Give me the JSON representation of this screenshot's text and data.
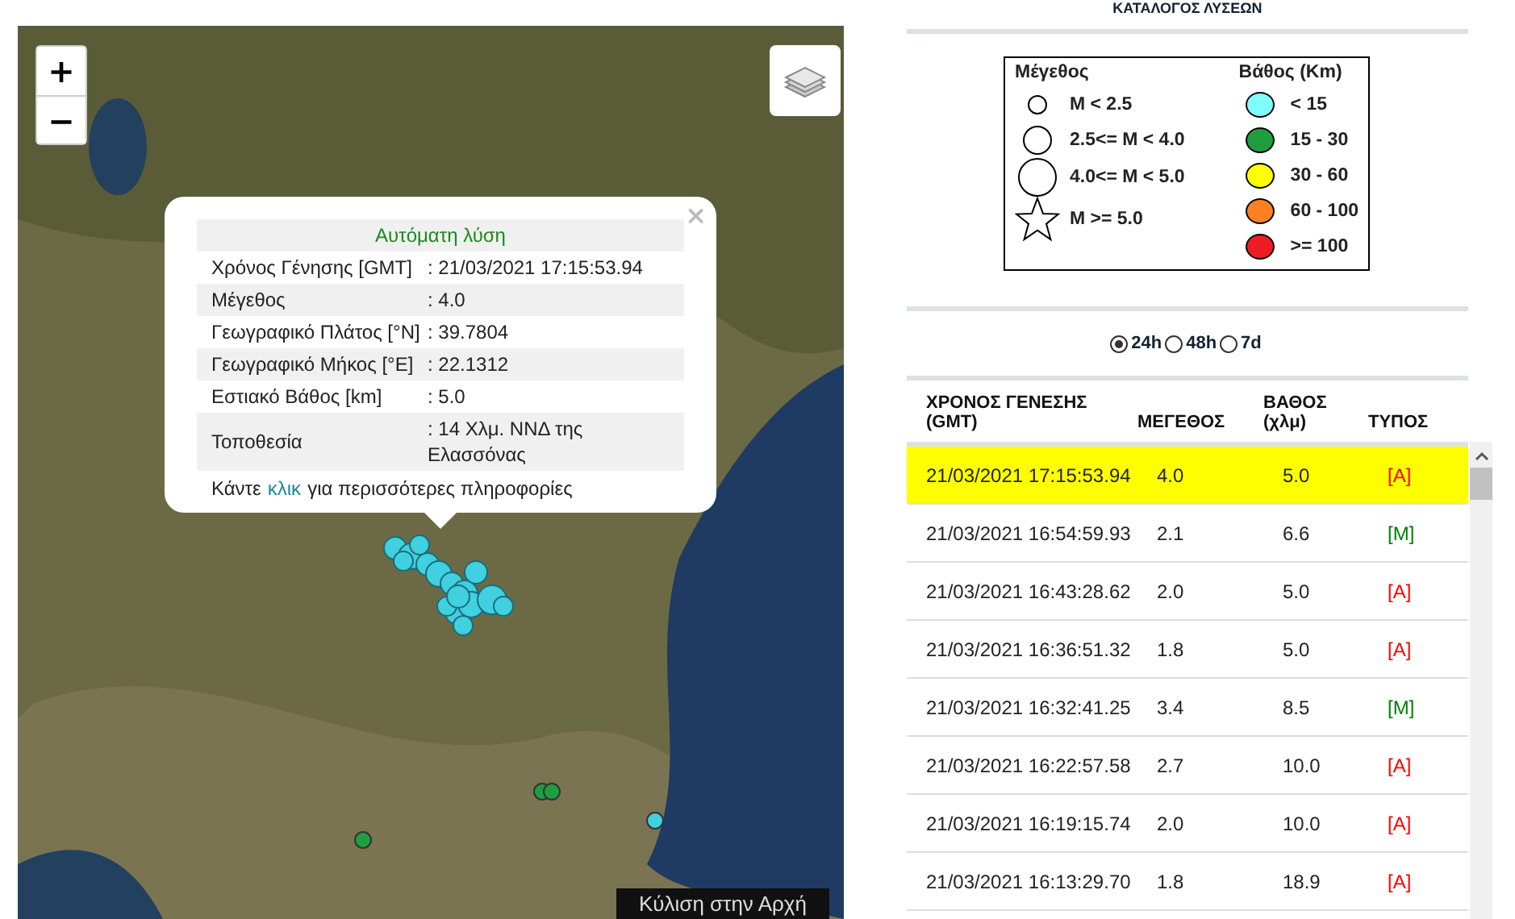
{
  "map": {
    "zoom_in": "+",
    "zoom_out": "−",
    "scroll_top": "Κύλιση στην Αρχή",
    "popup": {
      "close": "×",
      "title": "Αυτόματη λύση",
      "rows": [
        {
          "label": "Χρόνος Γένησης [GMT]",
          "value": ": 21/03/2021 17:15:53.94"
        },
        {
          "label": "Μέγεθος",
          "value": ": 4.0"
        },
        {
          "label": "Γεωγραφικό Πλάτος [°N]",
          "value": ": 39.7804"
        },
        {
          "label": "Γεωγραφικό Μήκος [°E]",
          "value": ": 22.1312"
        },
        {
          "label": "Εστιακό Βάθος [km]",
          "value": ": 5.0"
        },
        {
          "label": "Τοποθεσία",
          "value": ": 14 Χλμ. ΝΝΔ της Ελασσόνας"
        }
      ],
      "footer_before": "Κάντε",
      "footer_link": "κλικ",
      "footer_after": "για περισσότερες πληροφορίες"
    }
  },
  "panel": {
    "title": "ΚΑΤΑΛΟΓΟΣ ΛΥΣΕΩΝ",
    "legend": {
      "size_title": "Μέγεθος",
      "depth_title": "Βάθος (Km)",
      "sizes": [
        {
          "label": "M < 2.5",
          "kind": "small"
        },
        {
          "label": "2.5<= M < 4.0",
          "kind": "medium"
        },
        {
          "label": "4.0<= M < 5.0",
          "kind": "large"
        },
        {
          "label": "M >= 5.0",
          "kind": "star"
        }
      ],
      "depths": [
        {
          "label": "< 15",
          "color": "#80ffff"
        },
        {
          "label": "15 - 30",
          "color": "#1f9e40"
        },
        {
          "label": "30 - 60",
          "color": "#ffff00"
        },
        {
          "label": "60 - 100",
          "color": "#ff8020"
        },
        {
          "label": ">= 100",
          "color": "#ee1c24"
        }
      ]
    },
    "periods": [
      {
        "label": "24h",
        "selected": true
      },
      {
        "label": "48h",
        "selected": false
      },
      {
        "label": "7d",
        "selected": false
      }
    ],
    "table": {
      "columns": [
        "ΧΡΟΝΟΣ ΓΕΝΕΣΗΣ (GMT)",
        "ΜΕΓΕΘΟΣ",
        "ΒΑΘΟΣ (χλμ)",
        "ΤΥΠΟΣ"
      ],
      "rows": [
        {
          "time": "21/03/2021 17:15:53.94",
          "magnitude": "4.0",
          "depth": "5.0",
          "type": "[A]",
          "color": "#ff0000",
          "selected": true
        },
        {
          "time": "21/03/2021 16:54:59.93",
          "magnitude": "2.1",
          "depth": "6.6",
          "type": "[M]",
          "color": "#008000",
          "selected": false
        },
        {
          "time": "21/03/2021 16:43:28.62",
          "magnitude": "2.0",
          "depth": "5.0",
          "type": "[A]",
          "color": "#ff0000",
          "selected": false
        },
        {
          "time": "21/03/2021 16:36:51.32",
          "magnitude": "1.8",
          "depth": "5.0",
          "type": "[A]",
          "color": "#ff0000",
          "selected": false
        },
        {
          "time": "21/03/2021 16:32:41.25",
          "magnitude": "3.4",
          "depth": "8.5",
          "type": "[M]",
          "color": "#008000",
          "selected": false
        },
        {
          "time": "21/03/2021 16:22:57.58",
          "magnitude": "2.7",
          "depth": "10.0",
          "type": "[A]",
          "color": "#ff0000",
          "selected": false
        },
        {
          "time": "21/03/2021 16:19:15.74",
          "magnitude": "2.0",
          "depth": "10.0",
          "type": "[A]",
          "color": "#ff0000",
          "selected": false
        },
        {
          "time": "21/03/2021 16:13:29.70",
          "magnitude": "1.8",
          "depth": "18.9",
          "type": "[A]",
          "color": "#ff0000",
          "selected": false
        }
      ]
    }
  }
}
